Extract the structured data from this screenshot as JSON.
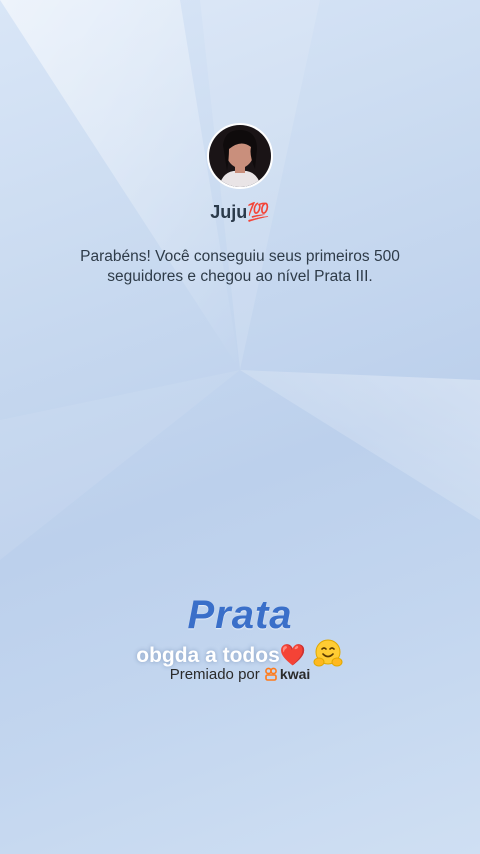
{
  "profile": {
    "username": "Juju💯",
    "avatar_icon": "profile-photo"
  },
  "achievement": {
    "message": "Parabéns! Você conseguiu seus primeiros 500 seguidores e chegou ao nível Prata III.",
    "rank": "Prata"
  },
  "caption": {
    "text": "obgda a todos",
    "heart": "❤️",
    "hug_icon": "hugging-face-icon"
  },
  "footer": {
    "awarded_by": "Premiado por",
    "brand": "kwai",
    "brand_icon": "kwai-logo-icon"
  },
  "colors": {
    "rank": "#3a6fc9",
    "background": "#c9daf0",
    "brand_accent": "#ff7a1a"
  }
}
